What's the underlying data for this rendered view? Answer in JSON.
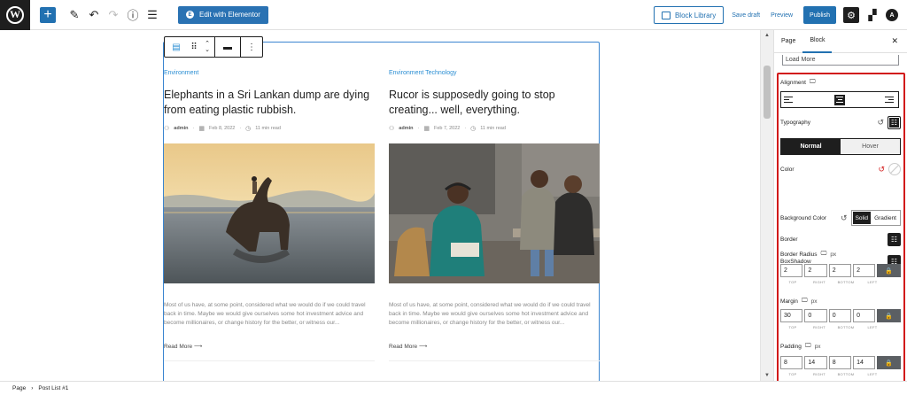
{
  "toolbar": {
    "elementor_label": "Edit with Elementor",
    "block_library_label": "Block Library",
    "save_draft_label": "Save draft",
    "preview_label": "Preview",
    "publish_label": "Publish"
  },
  "posts": [
    {
      "category": "Environment",
      "title": "Elephants in a Sri Lankan dump are dying from eating plastic rubbish.",
      "author": "admin",
      "date": "Feb 8, 2022",
      "read_time": "11 min read",
      "excerpt": "Most of us have, at some point, considered what we would do if we could travel back in time. Maybe we would give ourselves some hot investment advice and become millionaires, or change history for the better, or witness our...",
      "read_more": "Read More"
    },
    {
      "category": "Environment  Technology",
      "title": "Rucor is supposedly going to stop creating... well, everything.",
      "author": "admin",
      "date": "Feb 7, 2022",
      "read_time": "11 min read",
      "excerpt": "Most of us have, at some point, considered what we would do if we could travel back in time. Maybe we would give ourselves some hot investment advice and become millionaires, or change history for the better, or witness our...",
      "read_more": "Read More"
    }
  ],
  "sidebar": {
    "tab_page": "Page",
    "tab_block": "Block",
    "load_more_value": "Load More",
    "alignment_label": "Alignment",
    "typography_label": "Typography",
    "state_normal": "Normal",
    "state_hover": "Hover",
    "color_label": "Color",
    "background_color_label": "Background Color",
    "bg_solid": "Solid",
    "bg_gradient": "Gradient",
    "border_label": "Border",
    "boxshadow_label": "BoxShadow",
    "border_radius_label": "Border Radius",
    "margin_label": "Margin",
    "padding_label": "Padding",
    "unit": "px",
    "sides": [
      "TOP",
      "RIGHT",
      "BOTTOM",
      "LEFT"
    ],
    "border_radius": [
      "2",
      "2",
      "2",
      "2"
    ],
    "margin": [
      "30",
      "0",
      "0",
      "0"
    ],
    "padding": [
      "8",
      "14",
      "8",
      "14"
    ]
  },
  "breadcrumb": {
    "root": "Page",
    "separator": "›",
    "current": "Post List #1"
  },
  "colors": {
    "accent": "#2271b1",
    "highlight_border": "#d21a1a",
    "category_link": "#2a8ed3"
  }
}
